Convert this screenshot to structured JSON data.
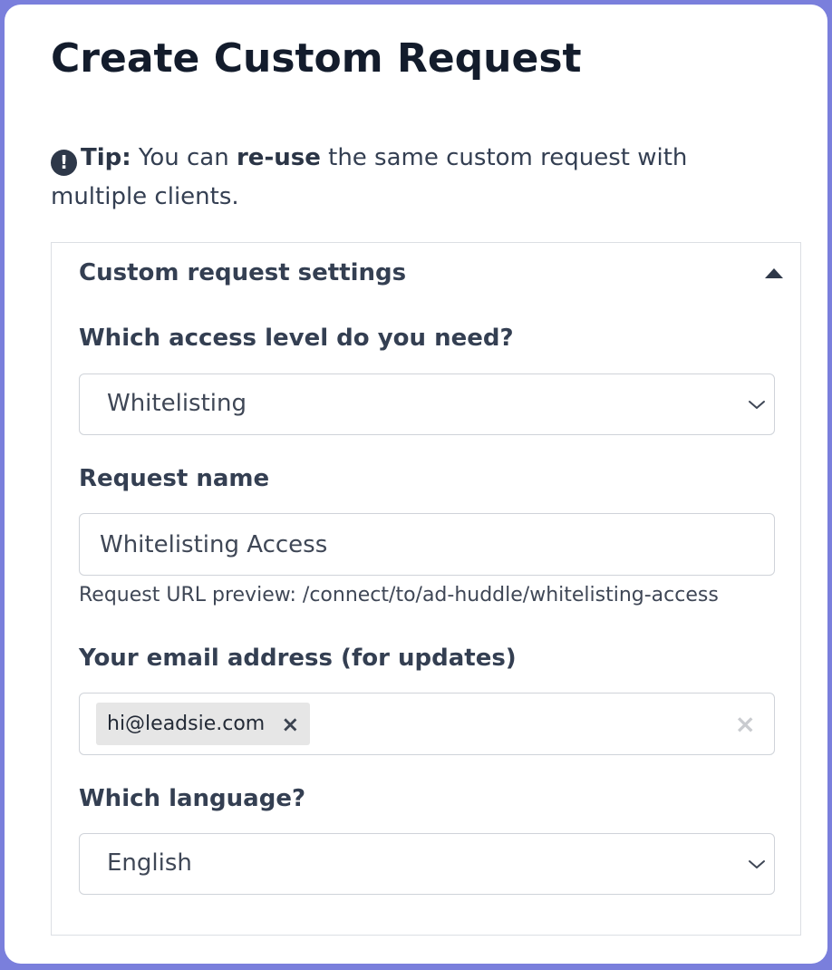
{
  "page": {
    "title": "Create Custom Request"
  },
  "tip": {
    "icon": "alert-circle-icon",
    "label": "Tip:",
    "text_before": " You can ",
    "bold_text": "re-use",
    "text_after": " the same custom request with multiple clients."
  },
  "settings": {
    "header": "Custom request settings",
    "collapse_icon": "caret-up-icon",
    "access_level": {
      "label": "Which access level do you need?",
      "selected": "Whitelisting"
    },
    "request_name": {
      "label": "Request name",
      "value": "Whitelisting Access",
      "url_preview": "Request URL preview: /connect/to/ad-huddle/whitelisting-access"
    },
    "email": {
      "label": "Your email address (for updates)",
      "tags": [
        "hi@leadsie.com"
      ],
      "tag_remove_glyph": "×",
      "clear_glyph": "×"
    },
    "language": {
      "label": "Which language?",
      "selected": "English"
    }
  },
  "colors": {
    "background": "#7a7fdc",
    "title": "#131c2c",
    "text": "#343f52",
    "border": "#cfd3d9",
    "tag_bg": "#e6e6e6"
  }
}
